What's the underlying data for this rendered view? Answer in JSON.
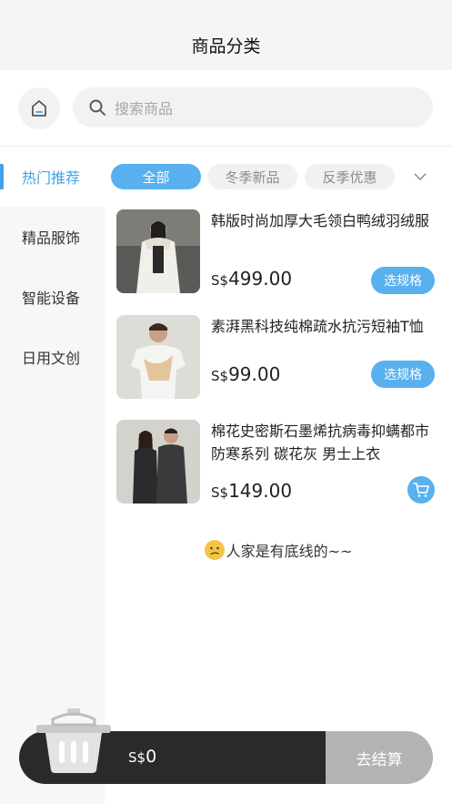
{
  "header": {
    "title": "商品分类"
  },
  "search": {
    "placeholder": "搜索商品",
    "home_icon": "home-icon",
    "search_icon": "search-icon"
  },
  "sidebar": {
    "items": [
      {
        "label": "热门推荐",
        "active": true
      },
      {
        "label": "精品服饰",
        "active": false
      },
      {
        "label": "智能设备",
        "active": false
      },
      {
        "label": "日用文创",
        "active": false
      }
    ]
  },
  "filters": {
    "chips": [
      {
        "label": "全部",
        "active": true
      },
      {
        "label": "冬季新品",
        "active": false
      },
      {
        "label": "反季优惠",
        "active": false
      }
    ],
    "expand_icon": "chevron-down-icon"
  },
  "products": [
    {
      "name": "韩版时尚加厚大毛领白鸭绒羽绒服",
      "currency": "S$",
      "price": "499.00",
      "action": "选规格"
    },
    {
      "name": "素湃黑科技纯棉疏水抗污短袖T恤",
      "currency": "S$",
      "price": "99.00",
      "action": "选规格"
    },
    {
      "name": "棉花史密斯石墨烯抗病毒抑螨都市防寒系列 碳花灰 男士上衣",
      "currency": "S$",
      "price": "149.00",
      "action_icon": "cart-icon"
    }
  ],
  "list_end_message": "人家是有底线的~~",
  "cart": {
    "currency": "S$",
    "total": "0",
    "checkout_label": "去结算"
  },
  "colors": {
    "accent": "#58b0ee",
    "cart_bar": "#2a2a2a",
    "checkout_disabled": "#b3b3b3"
  }
}
